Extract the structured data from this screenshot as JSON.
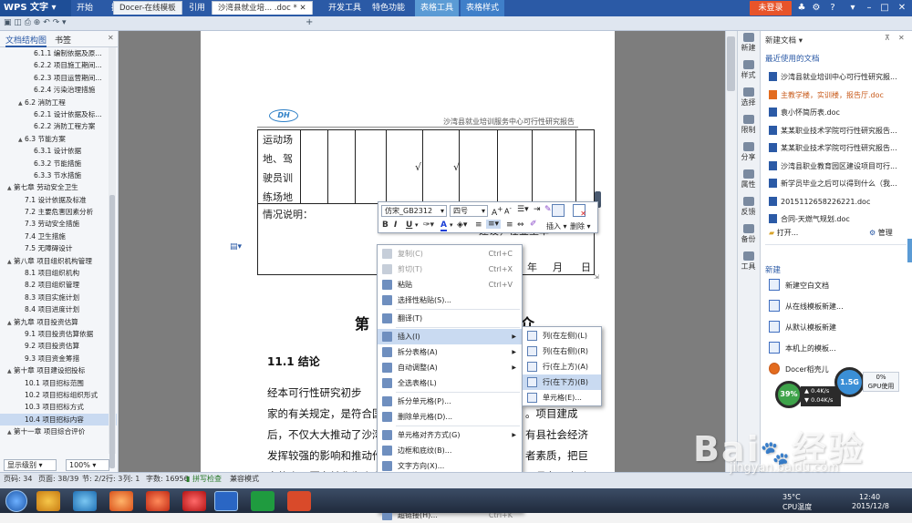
{
  "app": {
    "name": "WPS 文字"
  },
  "menu": {
    "items": [
      "开始",
      "插入",
      "页面布局",
      "引用",
      "审阅",
      "视图",
      "章节",
      "开发工具",
      "特色功能",
      "表格工具",
      "表格样式"
    ],
    "login": "未登录"
  },
  "tabs": [
    {
      "label": "Docer-在线模板"
    },
    {
      "label": "沙湾县就业培... .doc *"
    }
  ],
  "left_panel": {
    "tabs": [
      "文档结构图",
      "书签"
    ],
    "toc": [
      {
        "label": "6.1.1 编制依据及原...",
        "level": 3,
        "marker": ""
      },
      {
        "label": "6.2.2 项目施工期间...",
        "level": 3,
        "marker": ""
      },
      {
        "label": "6.2.3 项目运营期间...",
        "level": 3,
        "marker": ""
      },
      {
        "label": "6.2.4 污染治理措施",
        "level": 3,
        "marker": ""
      },
      {
        "label": "6.2 消防工程",
        "level": 2,
        "marker": "▲"
      },
      {
        "label": "6.2.1 设计依据及标...",
        "level": 3,
        "marker": ""
      },
      {
        "label": "6.2.2 消防工程方案",
        "level": 3,
        "marker": ""
      },
      {
        "label": "6.3 节能方案",
        "level": 2,
        "marker": "▲"
      },
      {
        "label": "6.3.1 设计依据",
        "level": 3,
        "marker": ""
      },
      {
        "label": "6.3.2 节能措施",
        "level": 3,
        "marker": ""
      },
      {
        "label": "6.3.3 节水措施",
        "level": 3,
        "marker": ""
      },
      {
        "label": "第七章 劳动安全卫生",
        "level": 1,
        "marker": "▲"
      },
      {
        "label": "7.1 设计依据及标准",
        "level": 2,
        "marker": ""
      },
      {
        "label": "7.2 主要危害因素分析",
        "level": 2,
        "marker": ""
      },
      {
        "label": "7.3 劳动安全措施",
        "level": 2,
        "marker": ""
      },
      {
        "label": "7.4 卫生措施",
        "level": 2,
        "marker": ""
      },
      {
        "label": "7.5 无障碍设计",
        "level": 2,
        "marker": ""
      },
      {
        "label": "第八章 项目组织机构管理",
        "level": 1,
        "marker": "▲"
      },
      {
        "label": "8.1 项目组织机构",
        "level": 2,
        "marker": ""
      },
      {
        "label": "8.2 项目组织管理",
        "level": 2,
        "marker": ""
      },
      {
        "label": "8.3 项目实施计划",
        "level": 2,
        "marker": ""
      },
      {
        "label": "8.4 项目进度计划",
        "level": 2,
        "marker": ""
      },
      {
        "label": "第九章 项目投资估算",
        "level": 1,
        "marker": "▲"
      },
      {
        "label": "9.1 项目投资估算依据",
        "level": 2,
        "marker": ""
      },
      {
        "label": "9.2 项目投资估算",
        "level": 2,
        "marker": ""
      },
      {
        "label": "9.3 项目资金筹措",
        "level": 2,
        "marker": ""
      },
      {
        "label": "第十章 项目建设招投标",
        "level": 1,
        "marker": "▲"
      },
      {
        "label": "10.1 项目招标范围",
        "level": 2,
        "marker": ""
      },
      {
        "label": "10.2 项目招标组织形式",
        "level": 2,
        "marker": ""
      },
      {
        "label": "10.3 项目招标方式",
        "level": 2,
        "marker": ""
      },
      {
        "label": "10.4 项目招标内容",
        "level": 2,
        "marker": "",
        "selected": true
      },
      {
        "label": "第十一章 项目综合评价",
        "level": 1,
        "marker": "▲"
      }
    ],
    "display_level": "显示级别",
    "zoom": "100%"
  },
  "document": {
    "header_text": "沙湾县就业培训服务中心可行性研究报告",
    "logo_text": "DH",
    "table_cell_lines": [
      "运动场",
      "地、驾",
      "驶员训",
      "练场地"
    ],
    "checkmarks": [
      "√",
      "√"
    ],
    "situation_label": "情况说明：",
    "partial_right": "建设，在业主单",
    "date_labels": [
      "年",
      "月",
      "日"
    ],
    "chapter_partial_left": "第",
    "chapter_partial_right": "介",
    "section_title": "11.1  结论",
    "body_lines": [
      {
        "left": "    经本可行性研究初步",
        "right": ""
      },
      {
        "left": "家的有关规定，是符合国",
        "right": "。项目建成"
      },
      {
        "left": "后，不仅大大推动了沙湾",
        "right": "有县社会经济"
      },
      {
        "left": "发挥较强的影响和推动作",
        "right": "者素质，把巨"
      },
      {
        "left": "大的人口压力转化为人力",
        "right": "已具备了启动"
      }
    ]
  },
  "format_toolbar": {
    "font": "仿宋_GB2312",
    "size": "四号",
    "insert_label": "插入",
    "delete_label": "删除",
    "buttons": [
      "B",
      "I",
      "U"
    ]
  },
  "context_menu": {
    "items": [
      {
        "label": "复制(C)",
        "shortcut": "Ctrl+C",
        "disabled": true
      },
      {
        "label": "剪切(T)",
        "shortcut": "Ctrl+X",
        "disabled": true
      },
      {
        "label": "粘贴",
        "shortcut": "Ctrl+V"
      },
      {
        "label": "选择性粘贴(S)..."
      },
      {
        "sep": true
      },
      {
        "label": "翻译(T)"
      },
      {
        "sep": true
      },
      {
        "label": "插入(I)",
        "submenu": true,
        "highlight": true
      },
      {
        "label": "拆分表格(A)",
        "submenu": true
      },
      {
        "label": "自动调整(A)",
        "submenu": true
      },
      {
        "label": "全选表格(L)"
      },
      {
        "sep": true
      },
      {
        "label": "拆分单元格(P)..."
      },
      {
        "label": "删除单元格(D)..."
      },
      {
        "sep": true
      },
      {
        "label": "单元格对齐方式(G)",
        "submenu": true
      },
      {
        "label": "边框和底纹(B)..."
      },
      {
        "label": "文字方向(X)..."
      },
      {
        "label": "表格属性(R)..."
      },
      {
        "sep": true
      },
      {
        "label": "项目符号和编号(N)..."
      },
      {
        "label": "超链接(H)...",
        "shortcut": "Ctrl+K"
      }
    ]
  },
  "submenu": {
    "items": [
      {
        "label": "列(在左侧)(L)"
      },
      {
        "label": "列(在右侧)(R)"
      },
      {
        "label": "行(在上方)(A)"
      },
      {
        "label": "行(在下方)(B)",
        "highlight": true
      },
      {
        "label": "单元格(E)..."
      }
    ]
  },
  "right_sidebar": {
    "items": [
      "新建",
      "样式",
      "选择",
      "限制",
      "分享",
      "属性",
      "反馈",
      "备份",
      "工具"
    ]
  },
  "task_pane": {
    "title": "新建文档",
    "recent_title": "最近使用的文档",
    "recent": [
      {
        "label": "沙湾县就业培训中心可行性研究报...",
        "kind": "doc"
      },
      {
        "label": "主教学楼，实训楼，报告厅.doc",
        "kind": "doc-orange"
      },
      {
        "label": "袁小怀简历表.doc",
        "kind": "doc"
      },
      {
        "label": "某某职业技术学院可行性研究报告...",
        "kind": "doc"
      },
      {
        "label": "某某职业技术学院可行性研究报告...",
        "kind": "doc"
      },
      {
        "label": "沙湾县职业教育园区建设项目可行...",
        "kind": "doc"
      },
      {
        "label": "新学员毕业之后可以得到什么（我...",
        "kind": "doc"
      },
      {
        "label": "2015112658226221.doc",
        "kind": "doc"
      },
      {
        "label": "合同-天燃气规划.doc",
        "kind": "doc"
      }
    ],
    "open_label": "打开...",
    "manage_label": "管理",
    "new_title": "新建",
    "new_items": [
      "新建空白文档",
      "从在线模板新建...",
      "从默认模板新建",
      "本机上的模板...",
      "Docer稻壳儿"
    ]
  },
  "gadgets": {
    "cpu_pct": "39%",
    "net_up": "0.4K/s",
    "net_down": "0.04K/s",
    "mem": "1.5G",
    "gpu_pct": "0%",
    "gpu_label": "GPU使用"
  },
  "status_bar": {
    "page": "页码: 34",
    "pages": "页面: 38/39",
    "section": "节: 2/2",
    "row": "行: 3",
    "col": "列: 1",
    "words": "字数: 16956",
    "spell": "拼写检查",
    "compat": "兼容模式"
  },
  "taskbar": {
    "temp": "35°C",
    "temp_label": "CPU温度",
    "time": "12:40",
    "date": "2015/12/8"
  },
  "watermark": {
    "brand": "Bai",
    "brand2": "经验",
    "url": "jingyan.baidu.com"
  }
}
